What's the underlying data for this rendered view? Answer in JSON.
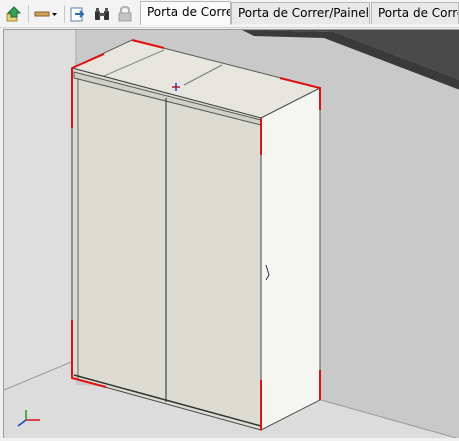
{
  "toolbar": {
    "buttons": [
      {
        "name": "up-level-icon",
        "color": "#2e8b57"
      },
      {
        "name": "line-style-dropdown-icon",
        "color": "#b07830"
      },
      {
        "name": "export-icon",
        "color": "#2f6fa8"
      },
      {
        "name": "binoculars-find-icon",
        "color": "#333333"
      },
      {
        "name": "lock-icon",
        "color": "#a0a0a0"
      }
    ]
  },
  "tabs": [
    {
      "label": "Porta de Correr",
      "active": true
    },
    {
      "label": "Porta de Correr/Painel Inf",
      "active": false
    },
    {
      "label": "Porta de Correr S",
      "active": false
    }
  ],
  "viewport": {
    "colors": {
      "wall": "#c7c7c7",
      "wall_dark": "#4a4a4a",
      "floor": "#d9d9d9",
      "cabinet_front": "#dcdcd4",
      "cabinet_side": "#f4f4f0",
      "cabinet_top": "#e8e8e2",
      "selection": "#e01010"
    },
    "axis_indicator": [
      "x",
      "y",
      "z"
    ]
  }
}
